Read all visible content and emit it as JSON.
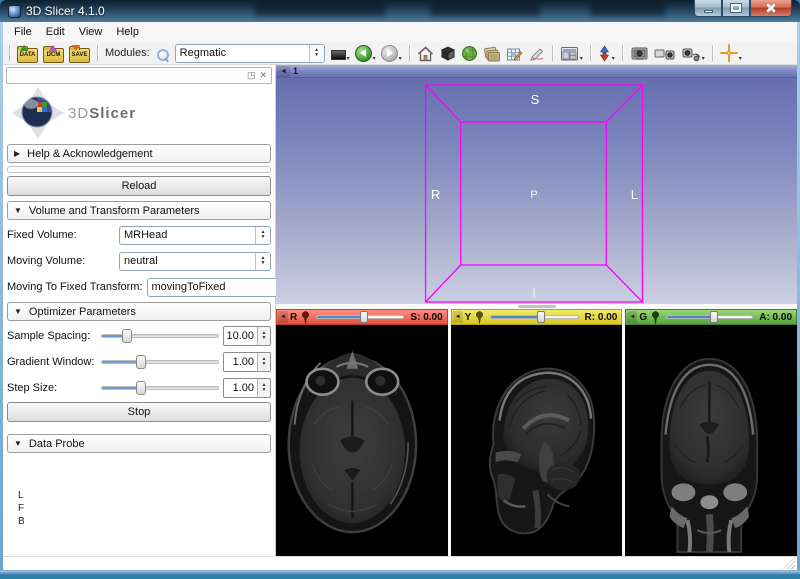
{
  "window": {
    "title": "3D Slicer 4.1.0"
  },
  "menu": [
    "File",
    "Edit",
    "View",
    "Help"
  ],
  "toolbar": {
    "load_buttons": [
      {
        "label": "DATA"
      },
      {
        "label": "DCM"
      },
      {
        "label": "SAVE"
      }
    ],
    "modules_label": "Modules:",
    "module_selected": "Regmatic"
  },
  "panel": {
    "logo": {
      "part1": "3D",
      "part2": "Slicer"
    },
    "help_header": "Help & Acknowledgement",
    "reload": "Reload",
    "volume_section": "Volume and Transform Parameters",
    "volume_rows": [
      {
        "label": "Fixed Volume:",
        "value": "MRHead"
      },
      {
        "label": "Moving Volume:",
        "value": "neutral"
      },
      {
        "label": "Moving To Fixed Transform:",
        "value": "movingToFixed"
      }
    ],
    "optimizer_section": "Optimizer Parameters",
    "optimizer_rows": [
      {
        "label": "Sample Spacing:",
        "value": "10.00"
      },
      {
        "label": "Gradient Window:",
        "value": "1.00"
      },
      {
        "label": "Step Size:",
        "value": "1.00"
      }
    ],
    "stop": "Stop",
    "data_probe": "Data Probe",
    "orientation": [
      "L",
      "F",
      "B"
    ]
  },
  "viewport": {
    "view3d_label": "1",
    "axes": {
      "s": "S",
      "r": "R",
      "p": "P",
      "l": "L",
      "i": "I"
    },
    "slices": [
      {
        "letter": "R",
        "value": "S: 0.00"
      },
      {
        "letter": "Y",
        "value": "R: 0.00"
      },
      {
        "letter": "G",
        "value": "A: 0.00"
      }
    ]
  },
  "icons": {
    "collapse_right": "▶",
    "collapse_down": "▼",
    "collapse_left": "◄",
    "panel_undock": "◳",
    "panel_close": "✕",
    "spin_up": "▲",
    "spin_down": "▼",
    "menu_dropdown": "▾"
  },
  "colors": {
    "slice_red": "#e8564a",
    "slice_yellow": "#d9c522",
    "slice_green": "#55a33a",
    "cube_wire": "#ff00ff",
    "view3d_top": "#666fae",
    "view3d_bottom": "#ccd0e2"
  }
}
